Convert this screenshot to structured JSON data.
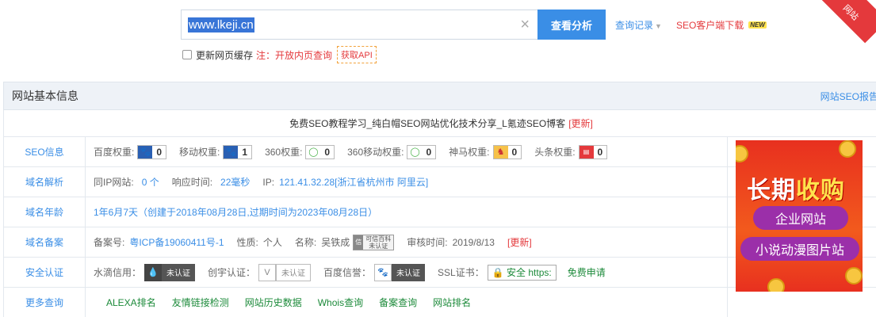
{
  "search": {
    "value": "www.lkeji.cn",
    "clear_icon": "close-icon",
    "button": "查看分析",
    "history": "查询记录",
    "seo_download": "SEO客户端下载",
    "new_badge": "NEW",
    "corner": "网站"
  },
  "options": {
    "refresh_cache": "更新网页缓存",
    "note": "注：开放内页查询",
    "api": "获取API"
  },
  "panel": {
    "title": "网站基本信息",
    "report_link": "网站SEO报告",
    "site_title": "免费SEO教程学习_纯白帽SEO网站优化技术分享_L氪迹SEO博客",
    "update": "[更新]"
  },
  "rows": {
    "seo": {
      "label": "SEO信息",
      "baidu_label": "百度权重:",
      "baidu_val": "0",
      "mobile_label": "移动权重:",
      "mobile_val": "1",
      "s360_label": "360权重:",
      "s360_val": "0",
      "s360m_label": "360移动权重:",
      "s360m_val": "0",
      "shenma_label": "神马权重:",
      "shenma_val": "0",
      "toutiao_label": "头条权重:",
      "toutiao_val": "0"
    },
    "dns": {
      "label": "域名解析",
      "ip_sites_label": "同IP网站:",
      "ip_sites_val": "0 个",
      "resp_label": "响应时间:",
      "resp_val": "22毫秒",
      "ip_label": "IP:",
      "ip_val": "121.41.32.28[浙江省杭州市 阿里云]"
    },
    "age": {
      "label": "域名年龄",
      "text": "1年6月7天（创建于2018年08月28日,过期时间为2023年08月28日）"
    },
    "icp": {
      "label": "域名备案",
      "no_label": "备案号:",
      "no_val": "粤ICP备19060411号-1",
      "type_label": "性质:",
      "type_val": "个人",
      "name_label": "名称:",
      "name_val": "吴铁成",
      "baike_top": "可信百科",
      "baike_bottom": "未认证",
      "date_label": "审核时间:",
      "date_val": "2019/8/13",
      "update": "[更新]"
    },
    "security": {
      "label": "安全认证",
      "shuidi_label": "水滴信用：",
      "shuidi_badge": "未认证",
      "chuangyu_label": "创宇认证：",
      "chuangyu_badge": "未认证",
      "baidu_label": "百度信誉：",
      "baidu_badge": "未认证",
      "ssl_label": "SSL证书：",
      "ssl_badge": "安全 https:",
      "apply": "免费申请"
    },
    "more": {
      "label": "更多查询",
      "links": [
        "ALEXA排名",
        "友情链接检测",
        "网站历史数据",
        "Whois查询",
        "备案查询",
        "网站排名"
      ]
    }
  },
  "ad": {
    "headline_a": "长期",
    "headline_b": "收购",
    "pill1": "企业网站",
    "pill2": "小说动漫图片站"
  }
}
